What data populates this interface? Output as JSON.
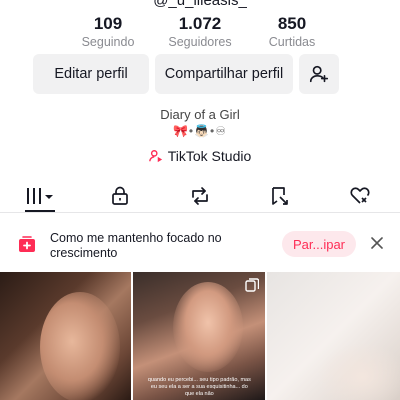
{
  "profile": {
    "handle_partial": "@_u_illeasis_"
  },
  "stats": [
    {
      "value": "109",
      "label": "Seguindo"
    },
    {
      "value": "1.072",
      "label": "Seguidores"
    },
    {
      "value": "850",
      "label": "Curtidas"
    }
  ],
  "buttons": {
    "edit_label": "Editar perfil",
    "share_label": "Compartilhar perfil"
  },
  "bio": {
    "line1": "Diary of a Girl",
    "line2": "🎀•👼🏻•♾"
  },
  "studio_label": "TikTok Studio",
  "tabs": [
    {
      "name": "videos-grid",
      "icon": "grid-icon"
    },
    {
      "name": "private",
      "icon": "lock-icon"
    },
    {
      "name": "reposts",
      "icon": "repost-icon"
    },
    {
      "name": "favorites",
      "icon": "bookmark-icon"
    },
    {
      "name": "liked",
      "icon": "heart-icon"
    }
  ],
  "banner": {
    "text": "Como me mantenho focado no crescimento",
    "button_label": "Par...ipar"
  },
  "grid": {
    "caption2": "quando eu percebi... seu tipo padrão, mas eu seu ela a ser a sua esquisitinha... do que ela não"
  },
  "colors": {
    "accent": "#fe2c55",
    "secondary_text": "#8a8b91",
    "button_bg": "#f1f1f2"
  }
}
